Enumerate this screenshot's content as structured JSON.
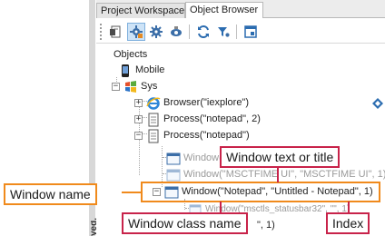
{
  "tabs": [
    {
      "label": "Project Workspace",
      "active": false
    },
    {
      "label": "Object Browser",
      "active": true
    }
  ],
  "left_vertical_text": "yed.",
  "tree": {
    "root_label": "Objects",
    "mobile_label": "Mobile",
    "sys_label": "Sys",
    "browser_label": "Browser(\"iexplore\")",
    "process1_label": "Process(\"notepad\", 2)",
    "process2_label": "Process(\"notepad\")",
    "window_top_label": "Window(",
    "window_msctf_label": "Window(\"MSCTFIME UI\", \"MSCTFIME UI\", 1)",
    "window_notepad_label": "Window(\"Notepad\", \"Untitled - Notepad\", 1)",
    "window_statusbar_label": "Window(\"msctls_statusbar32\", \"\", 1)",
    "window_bottom_label": "\", 1)"
  },
  "callouts": {
    "window_text": "Window text or title",
    "window_name": "Window name",
    "window_class": "Window class name",
    "index": "Index"
  },
  "colors": {
    "callout_red": "#c8234a",
    "callout_orange": "#f08a1c",
    "accent_blue": "#2b6cb0"
  },
  "icons": {
    "toolbar": [
      "object-icon",
      "mapped-objects-icon",
      "settings-icon",
      "highlight-icon",
      "refresh-icon",
      "filter-icon",
      "properties-icon"
    ],
    "tree": [
      "mobile-icon",
      "windows-flag-icon",
      "browser-icon",
      "process-icon",
      "window-icon"
    ]
  }
}
